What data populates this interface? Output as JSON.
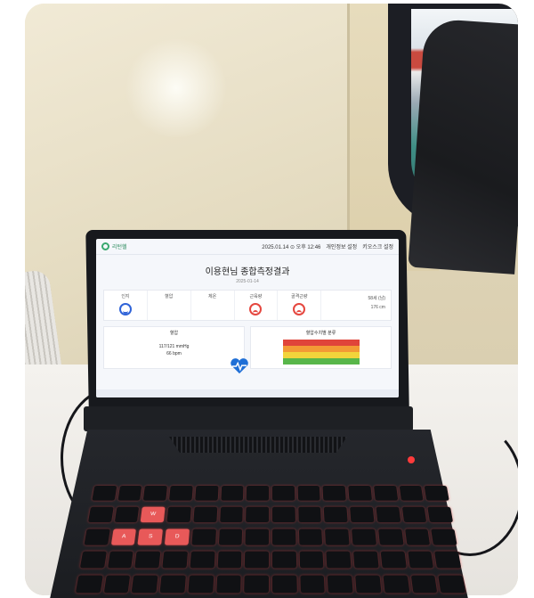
{
  "screen": {
    "app_logo": "리턴헬",
    "topbar_datetime": "2025.01.14 ⊙ 오후 12:46",
    "topbar_link_1": "개인정보 설정",
    "topbar_link_2": "키오스크 설정",
    "report_title": "이용현님 종합측정결과",
    "report_date": "2025-01-14",
    "metrics": [
      {
        "label": "인지",
        "status": "good"
      },
      {
        "label": "혈압",
        "status": "good"
      },
      {
        "label": "체온",
        "status": "good"
      },
      {
        "label": "근육량",
        "status": "bad"
      },
      {
        "label": "골격근량",
        "status": "bad"
      }
    ],
    "bio": {
      "age_value": "58세 (남)",
      "height_value": "176 cm"
    },
    "bp_panel": {
      "title": "혈압",
      "reading": "117/121 mmHg",
      "pulse": "66 bpm"
    },
    "chart_panel": {
      "title": "혈압수치별 분류"
    }
  },
  "colors": {
    "good_face": "#2f63d8",
    "bad_face": "#e5473f",
    "heart": "#1f6fd6",
    "band_red": "#e0443a",
    "band_orange": "#f39a35",
    "band_yellow": "#f2d43b",
    "band_green": "#58b64a"
  },
  "keyboard": {
    "lit_keys": [
      "W",
      "A",
      "S",
      "D"
    ]
  }
}
